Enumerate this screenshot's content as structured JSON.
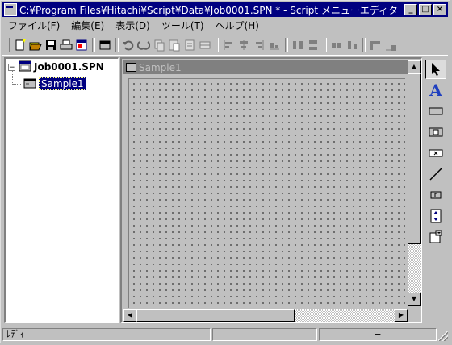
{
  "window": {
    "title": "C:¥Program Files¥Hitachi¥Script¥Data¥Job0001.SPN * - Script メニューエディタ",
    "minimize_glyph": "_",
    "maximize_glyph": "□",
    "close_glyph": "×",
    "title_bg": "#000080"
  },
  "menu": [
    "ファイル(F)",
    "編集(E)",
    "表示(D)",
    "ツール(T)",
    "ヘルプ(H)"
  ],
  "toolbar_icons": [
    "new-icon",
    "open-icon",
    "save-icon",
    "print-icon",
    "properties-icon",
    "sheet-icon",
    "undo-icon",
    "redo-icon",
    "copy-icon",
    "paste-icon",
    "delete-icon",
    "grid-icon",
    "align-left-icon",
    "align-center-icon",
    "align-right-icon",
    "align-bottom-icon",
    "space-horizontal-icon",
    "space-vertical-icon",
    "same-width-icon",
    "same-height-icon",
    "size-left-icon",
    "size-right-icon"
  ],
  "tree": {
    "root_label": "Job0001.SPN",
    "root_expander": "−",
    "child_label": "Sample1"
  },
  "editor": {
    "child_title": "Sample1",
    "scroll_up": "▲",
    "scroll_down": "▼",
    "scroll_left": "◀",
    "scroll_right": "▶"
  },
  "palette_icons": [
    "pointer-icon",
    "text-icon",
    "button-icon",
    "picture-button-icon",
    "input-field-icon",
    "line-icon",
    "counter-icon",
    "spin-icon",
    "dropdown-icon"
  ],
  "palette": {
    "text_tool_glyph": "A"
  },
  "status": {
    "ready_text": "ﾚﾃﾞｨ",
    "pane2_text": "",
    "pane3_text": "−"
  }
}
